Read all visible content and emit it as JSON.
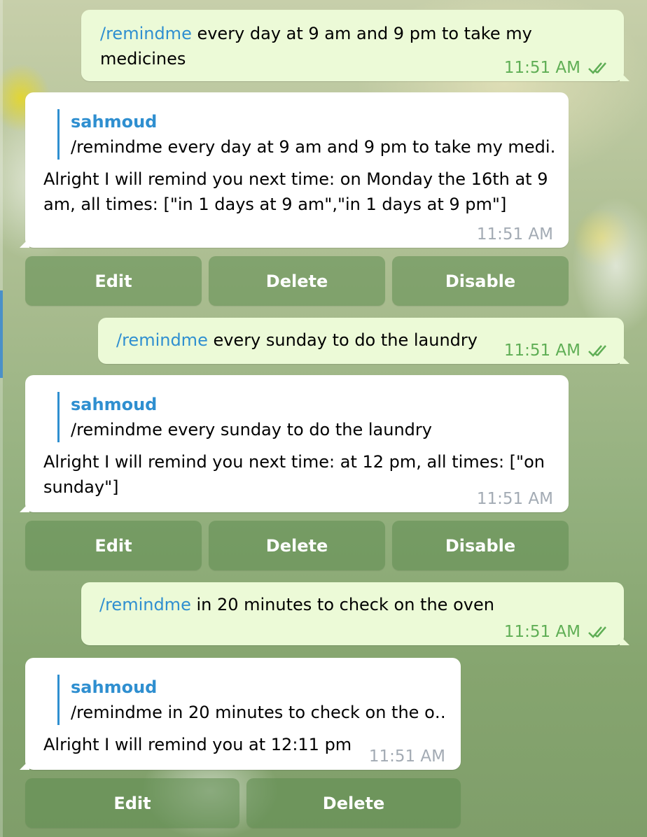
{
  "messages": [
    {
      "type": "outgoing",
      "command": "/remindme",
      "line1": " every day at 9 am and 9 pm to take my",
      "line2": "medicines",
      "time": "11:51 AM"
    },
    {
      "type": "incoming",
      "reply_author": "sahmoud",
      "reply_text": "/remindme every day at 9 am and 9 pm to take my medi…",
      "line1": "Alright I will remind you next time: on Monday the 16th at 9",
      "line2": "am, all times: [\"in 1 days at 9 am\",\"in 1 days at 9 pm\"]",
      "time": "11:51 AM",
      "buttons": [
        "Edit",
        "Delete",
        "Disable"
      ]
    },
    {
      "type": "outgoing",
      "command": "/remindme",
      "line1": " every sunday to do the laundry",
      "time": "11:51 AM"
    },
    {
      "type": "incoming",
      "reply_author": "sahmoud",
      "reply_text": "/remindme every sunday to do the laundry",
      "line1": "Alright I will remind you next time: at 12 pm, all times: [\"on",
      "line2": "sunday\"]",
      "time": "11:51 AM",
      "buttons": [
        "Edit",
        "Delete",
        "Disable"
      ]
    },
    {
      "type": "outgoing",
      "command": "/remindme",
      "line1": " in 20 minutes to check on the oven",
      "time": "11:51 AM"
    },
    {
      "type": "incoming",
      "reply_author": "sahmoud",
      "reply_text": "/remindme in 20 minutes to check on the o…",
      "line1": "Alright I will remind you at 12:11 pm",
      "time": "11:51 AM",
      "buttons": [
        "Edit",
        "Delete"
      ]
    }
  ],
  "colors": {
    "outgoing_bubble": "#ecfad7",
    "incoming_bubble": "#ffffff",
    "command_link": "#2f8fd0",
    "read_check": "#5fae55",
    "keyboard_button": "#5f8c50"
  }
}
